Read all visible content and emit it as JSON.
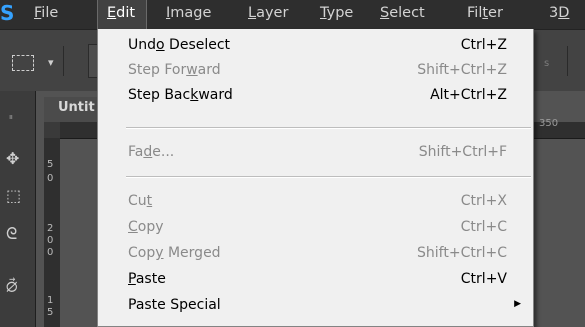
{
  "app": {
    "logo_text": "S"
  },
  "menubar": {
    "items": [
      {
        "pre": "",
        "ul": "F",
        "post": "ile"
      },
      {
        "pre": "",
        "ul": "E",
        "post": "dit"
      },
      {
        "pre": "",
        "ul": "I",
        "post": "mage"
      },
      {
        "pre": "",
        "ul": "L",
        "post": "ayer"
      },
      {
        "pre": "",
        "ul": "T",
        "post": "ype"
      },
      {
        "pre": "",
        "ul": "S",
        "post": "elect"
      },
      {
        "pre": "Fil",
        "ul": "t",
        "post": "er"
      },
      {
        "pre": "3",
        "ul": "D",
        "post": ""
      }
    ]
  },
  "options_bar": {
    "faded_text": "s",
    "dropdown_icon": "chevron-down-icon"
  },
  "tools": [
    {
      "name": "move-tool-icon",
      "glyph": "✥"
    },
    {
      "name": "marquee-tool-icon",
      "glyph": "⬚"
    },
    {
      "name": "lasso-tool-icon",
      "glyph": "ᘓ"
    },
    {
      "name": "quick-select-tool-icon",
      "glyph": "⦳"
    }
  ],
  "document": {
    "tab_label": "Untit",
    "ruler_label": "350",
    "vruler_digits": [
      "5",
      "0",
      "",
      "2",
      "0",
      "0",
      "",
      "1",
      "5"
    ]
  },
  "edit_menu": {
    "items": [
      {
        "pre": "Und",
        "ul": "o",
        "post": " Deselect",
        "shortcut": "Ctrl+Z",
        "enabled": true
      },
      {
        "pre": "Step For",
        "ul": "w",
        "post": "ard",
        "shortcut": "Shift+Ctrl+Z",
        "enabled": false
      },
      {
        "pre": "Step Bac",
        "ul": "k",
        "post": "ward",
        "shortcut": "Alt+Ctrl+Z",
        "enabled": true
      },
      {
        "pre": "Fa",
        "ul": "d",
        "post": "e...",
        "shortcut": "Shift+Ctrl+F",
        "enabled": false
      },
      {
        "pre": "Cu",
        "ul": "t",
        "post": "",
        "shortcut": "Ctrl+X",
        "enabled": false
      },
      {
        "pre": "",
        "ul": "C",
        "post": "opy",
        "shortcut": "Ctrl+C",
        "enabled": false
      },
      {
        "pre": "Cop",
        "ul": "y",
        "post": " Merged",
        "shortcut": "Shift+Ctrl+C",
        "enabled": false
      },
      {
        "pre": "",
        "ul": "P",
        "post": "aste",
        "shortcut": "Ctrl+V",
        "enabled": true
      },
      {
        "pre": "Paste Special",
        "ul": "",
        "post": "",
        "shortcut": "",
        "enabled": true,
        "submenu": true
      }
    ]
  }
}
